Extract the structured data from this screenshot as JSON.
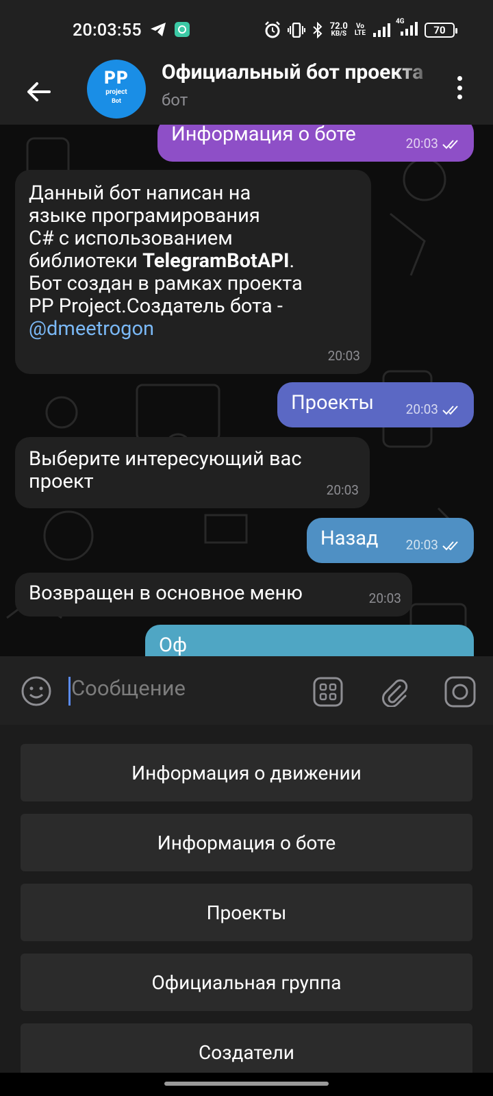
{
  "status_bar": {
    "time": "20:03:55",
    "net_speed_value": "72.0",
    "net_speed_unit": "KB/S",
    "volte": "Vo\nLTE",
    "network": "4G",
    "battery": "70"
  },
  "header": {
    "title": "Официальный бот проекта",
    "subtitle": "бот",
    "avatar_line1": "PP",
    "avatar_line2": "project",
    "avatar_line3": "Bot"
  },
  "messages": [
    {
      "direction": "out",
      "text": "Информация о боте",
      "time": "20:03",
      "color": "#8e4fc7"
    },
    {
      "direction": "in",
      "text_lines": [
        "Данный бот написан на",
        "языке  програмирования",
        "C# с использованием",
        "библиотеки ",
        "TelegramBotAPI",
        ".",
        "Бот создан в рамках проекта",
        "PP Project.Создатель бота -",
        "@dmeetrogon"
      ],
      "time": "20:03"
    },
    {
      "direction": "out",
      "text": "Проекты",
      "time": "20:03",
      "color": "#5b68c4"
    },
    {
      "direction": "in",
      "text_lines": [
        "Выберите интересующий вас",
        "проект"
      ],
      "time": "20:03"
    },
    {
      "direction": "out",
      "text": "Назад",
      "time": "20:03",
      "color": "#4f90c4"
    },
    {
      "direction": "in",
      "text_lines": [
        "Возвращен в основное меню"
      ],
      "time": "20:03"
    },
    {
      "direction": "out",
      "text": "Оф",
      "time": "",
      "color": "#4fa6c4"
    }
  ],
  "input": {
    "placeholder": "Сообщение"
  },
  "keyboard": {
    "buttons": [
      "Информация о движении",
      "Информация о боте",
      "Проекты",
      "Официальная группа",
      "Создатели"
    ]
  }
}
